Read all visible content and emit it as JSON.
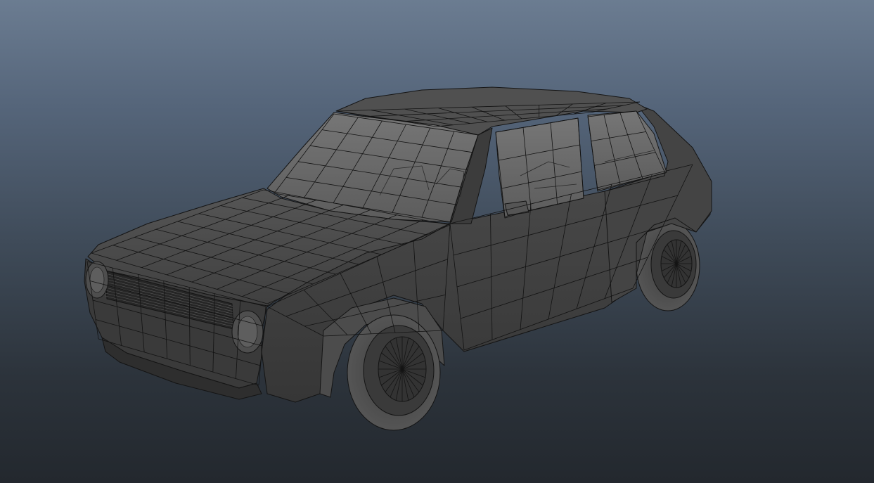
{
  "viewport": {
    "background_top": "#6b7c91",
    "background_bottom": "#23282e"
  },
  "model": {
    "subject": "car",
    "display_mode": "shaded-with-wireframe",
    "shade_color": "#474747",
    "shade_light_color": "#585858",
    "shade_dark_color": "#2e2e2e",
    "glass_color": "#6b6b6b",
    "wire_color": "#121212"
  }
}
